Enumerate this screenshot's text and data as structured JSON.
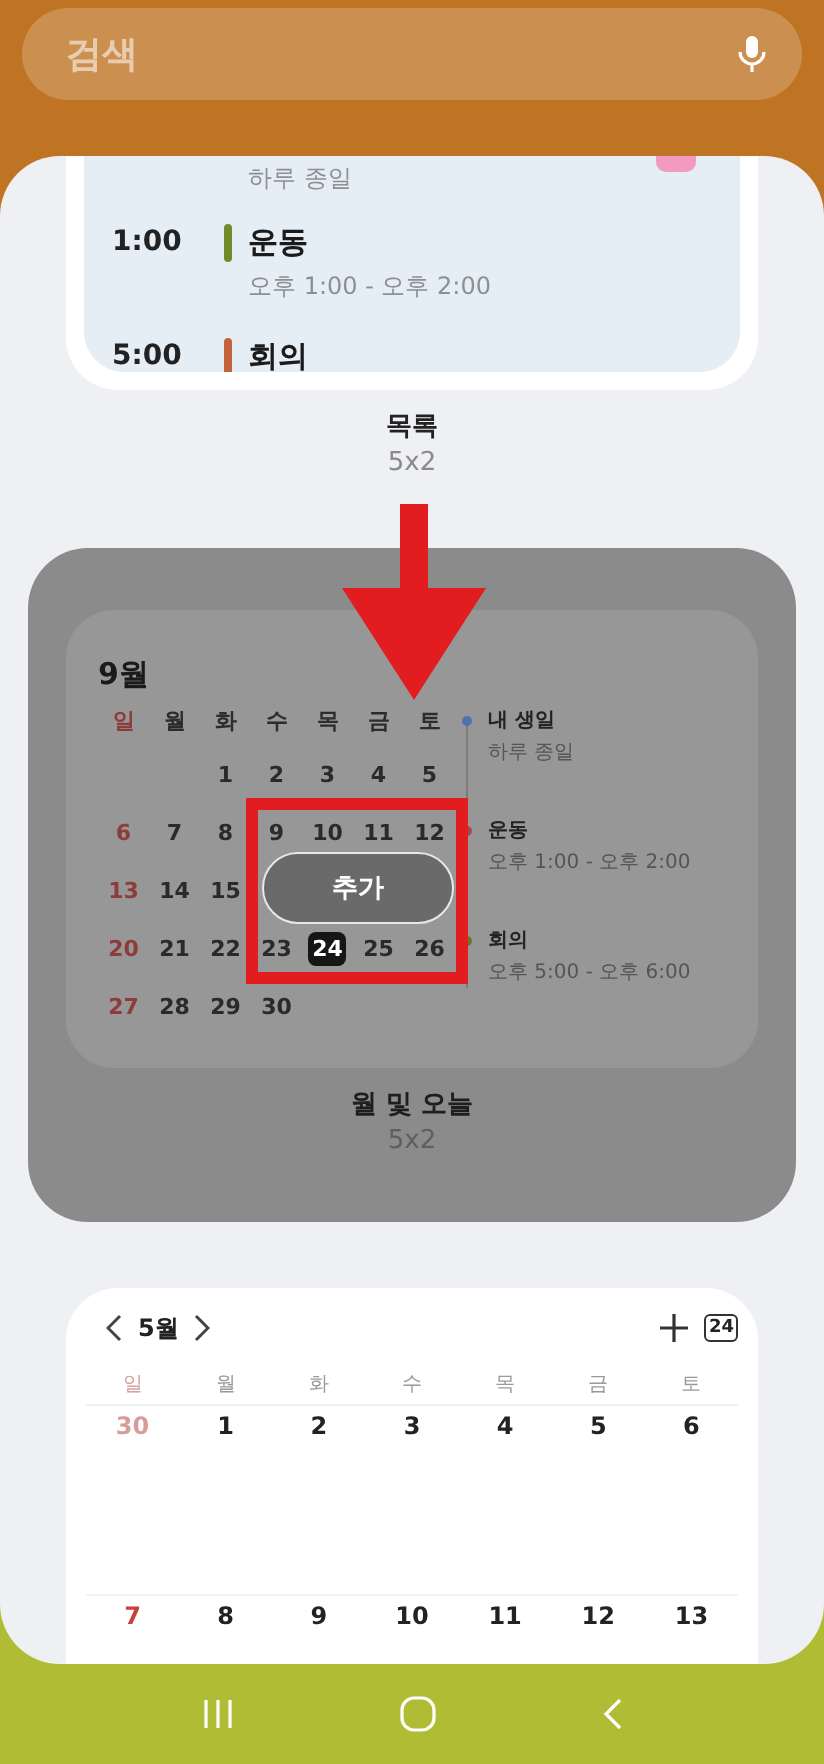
{
  "search": {
    "placeholder": "검색"
  },
  "widgets": [
    {
      "kind": "list",
      "selected": false,
      "name": "목록",
      "size": "5x2",
      "events": [
        {
          "subtitle": "하루 종일"
        },
        {
          "time": "1:00",
          "title": "운동",
          "subtitle": "오후 1:00 - 오후 2:00",
          "color": "#6e8c2a"
        },
        {
          "time": "5:00",
          "title": "회의",
          "color": "#c4623e"
        }
      ]
    },
    {
      "kind": "month_today",
      "selected": true,
      "name": "월 및 오늘",
      "size": "5x2",
      "month": "9월",
      "add_button": "추가",
      "weekdays": [
        "일",
        "월",
        "화",
        "수",
        "목",
        "금",
        "토"
      ],
      "weeks": [
        {
          "kind": "first",
          "days": [
            {
              "d": "1",
              "today": false
            },
            {
              "d": "2",
              "today": false
            },
            {
              "d": "3",
              "today": false
            },
            {
              "d": "4",
              "today": false
            },
            {
              "d": "5",
              "today": false
            }
          ]
        },
        {
          "kind": "regular",
          "days": [
            {
              "d": "6",
              "today": false
            },
            {
              "d": "7",
              "today": false
            },
            {
              "d": "8",
              "today": false
            },
            {
              "d": "9",
              "today": false
            },
            {
              "d": "10",
              "today": false
            },
            {
              "d": "11",
              "today": false
            },
            {
              "d": "12",
              "today": false
            }
          ]
        },
        {
          "kind": "regular",
          "days": [
            {
              "d": "13",
              "today": false
            },
            {
              "d": "14",
              "today": false
            },
            {
              "d": "15",
              "today": false
            }
          ]
        },
        {
          "kind": "regular",
          "days": [
            {
              "d": "20",
              "today": false
            },
            {
              "d": "21",
              "today": false
            },
            {
              "d": "22",
              "today": false
            },
            {
              "d": "23",
              "today": false
            },
            {
              "d": "24",
              "today": true
            },
            {
              "d": "25",
              "today": false
            },
            {
              "d": "26",
              "today": false
            }
          ]
        },
        {
          "kind": "regular",
          "days": [
            {
              "d": "27",
              "today": false
            },
            {
              "d": "28",
              "today": false
            },
            {
              "d": "29",
              "today": false
            },
            {
              "d": "30",
              "today": false
            }
          ]
        }
      ],
      "events": [
        {
          "title": "내 생일",
          "subtitle": "하루 종일",
          "color": "#4f72b0"
        },
        {
          "title": "운동",
          "subtitle": "오후 1:00 - 오후 2:00",
          "color": "#a94848"
        },
        {
          "title": "회의",
          "subtitle": "오후 5:00 - 오후 6:00",
          "color": "#647a26"
        }
      ]
    },
    {
      "kind": "month",
      "selected": false,
      "month": "5월",
      "today_icon": "24",
      "weekdays": [
        "일",
        "월",
        "화",
        "수",
        "목",
        "금",
        "토"
      ],
      "weeks": [
        {
          "days": [
            {
              "d": "30",
              "outside": true
            },
            {
              "d": "1",
              "outside": false
            },
            {
              "d": "2",
              "outside": false
            },
            {
              "d": "3",
              "outside": false
            },
            {
              "d": "4",
              "outside": false
            },
            {
              "d": "5",
              "outside": false
            },
            {
              "d": "6",
              "outside": false
            }
          ]
        },
        {
          "days": [
            {
              "d": "7",
              "outside": false
            },
            {
              "d": "8",
              "outside": false
            },
            {
              "d": "9",
              "outside": false
            },
            {
              "d": "10",
              "outside": false
            },
            {
              "d": "11",
              "outside": false
            },
            {
              "d": "12",
              "outside": false
            },
            {
              "d": "13",
              "outside": false
            }
          ]
        }
      ]
    }
  ]
}
